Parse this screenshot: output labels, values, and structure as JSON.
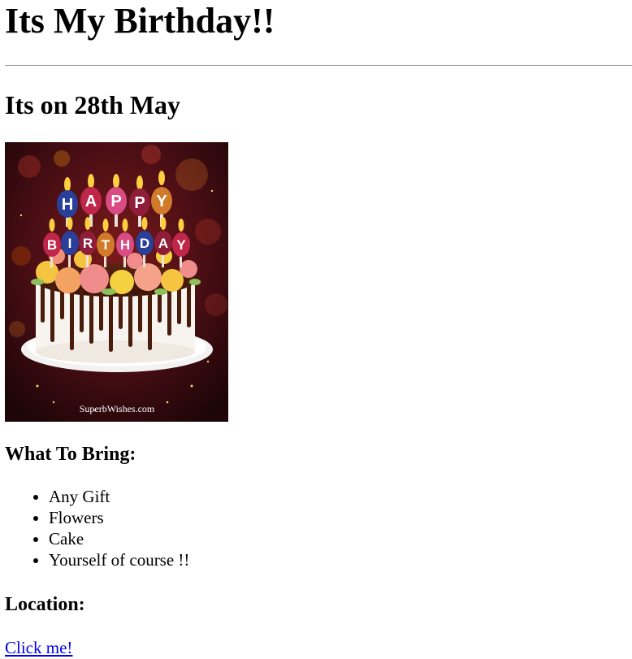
{
  "page": {
    "title": "Its My Birthday!!",
    "date_heading": "Its on 28th May",
    "image": {
      "word_top": [
        "H",
        "A",
        "P",
        "P",
        "Y"
      ],
      "word_bottom": [
        "B",
        "I",
        "R",
        "T",
        "H",
        "D",
        "A",
        "Y"
      ],
      "watermark": "SuperbWishes.com"
    },
    "bring_heading": "What To Bring:",
    "bring_items": [
      "Any Gift",
      "Flowers",
      "Cake",
      "Yourself of course !!"
    ],
    "location_heading": "Location:",
    "location_link": "Click me!"
  },
  "colors": {
    "link": "#0000ee",
    "rule": "#9a9a9a"
  }
}
